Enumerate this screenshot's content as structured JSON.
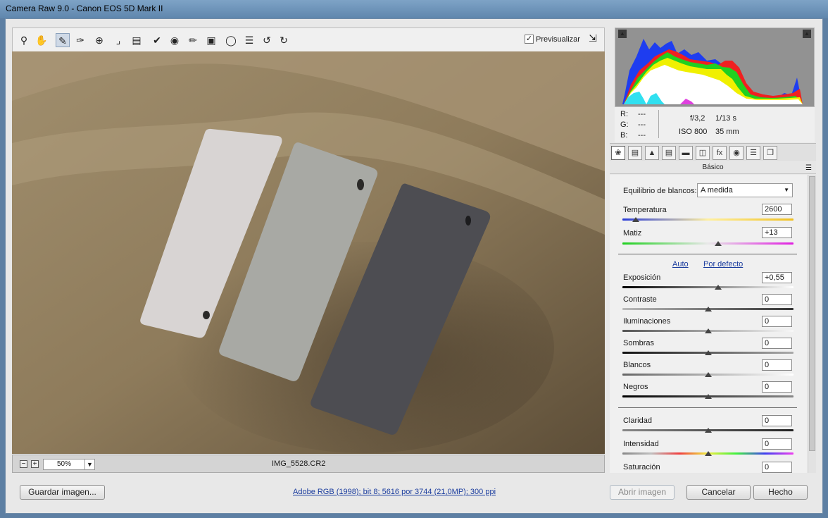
{
  "window": {
    "title": "Camera Raw 9.0 -  Canon EOS 5D Mark II"
  },
  "toolbar": {
    "tools": [
      "zoom-icon",
      "hand-icon",
      "white-balance-icon",
      "color-sampler-icon",
      "targeted-adjustment-icon",
      "crop-icon",
      "straighten-icon",
      "spot-removal-icon",
      "red-eye-icon",
      "adjustment-brush-icon",
      "graduated-filter-icon",
      "radial-filter-icon",
      "open-preferences-icon",
      "rotate-ccw-icon",
      "rotate-cw-icon"
    ],
    "preview_label": "Previsualizar",
    "preview_checked": true
  },
  "status": {
    "zoom": "50%",
    "filename": "IMG_5528.CR2"
  },
  "histogram": {
    "clipping_shadow_label": "▲",
    "clipping_highlight_label": "▲"
  },
  "info": {
    "r_label": "R:",
    "g_label": "G:",
    "b_label": "B:",
    "r_val": "---",
    "g_val": "---",
    "b_val": "---",
    "aperture": "f/3,2",
    "shutter": "1/13 s",
    "iso": "ISO 800",
    "focal": "35 mm"
  },
  "tabs": [
    "basic-icon",
    "tone-curve-icon",
    "detail-icon",
    "hsl-icon",
    "split-toning-icon",
    "lens-corrections-icon",
    "effects-icon",
    "camera-calibration-icon",
    "presets-icon",
    "snapshots-icon"
  ],
  "panel": {
    "title": "Básico",
    "wb_label": "Equilibrio de blancos:",
    "wb_value": "A medida",
    "temperature": {
      "label": "Temperatura",
      "value": "2600",
      "position": 0.08
    },
    "tint": {
      "label": "Matiz",
      "value": "+13",
      "position": 0.56
    },
    "auto_label": "Auto",
    "default_label": "Por defecto",
    "exposure": {
      "label": "Exposición",
      "value": "+0,55",
      "position": 0.56
    },
    "contrast": {
      "label": "Contraste",
      "value": "0",
      "position": 0.5
    },
    "highlights": {
      "label": "Iluminaciones",
      "value": "0",
      "position": 0.5
    },
    "shadows": {
      "label": "Sombras",
      "value": "0",
      "position": 0.5
    },
    "whites": {
      "label": "Blancos",
      "value": "0",
      "position": 0.5
    },
    "blacks": {
      "label": "Negros",
      "value": "0",
      "position": 0.5
    },
    "clarity": {
      "label": "Claridad",
      "value": "0",
      "position": 0.5
    },
    "vibrance": {
      "label": "Intensidad",
      "value": "0",
      "position": 0.5
    },
    "saturation": {
      "label": "Saturación",
      "value": "0",
      "position": 0.5
    }
  },
  "bottom": {
    "save_label": "Guardar imagen...",
    "workflow_link": "Adobe RGB (1998); bit 8; 5616 por 3744 (21,0MP); 300 ppi",
    "open_label": "Abrir imagen",
    "cancel_label": "Cancelar",
    "done_label": "Hecho"
  }
}
